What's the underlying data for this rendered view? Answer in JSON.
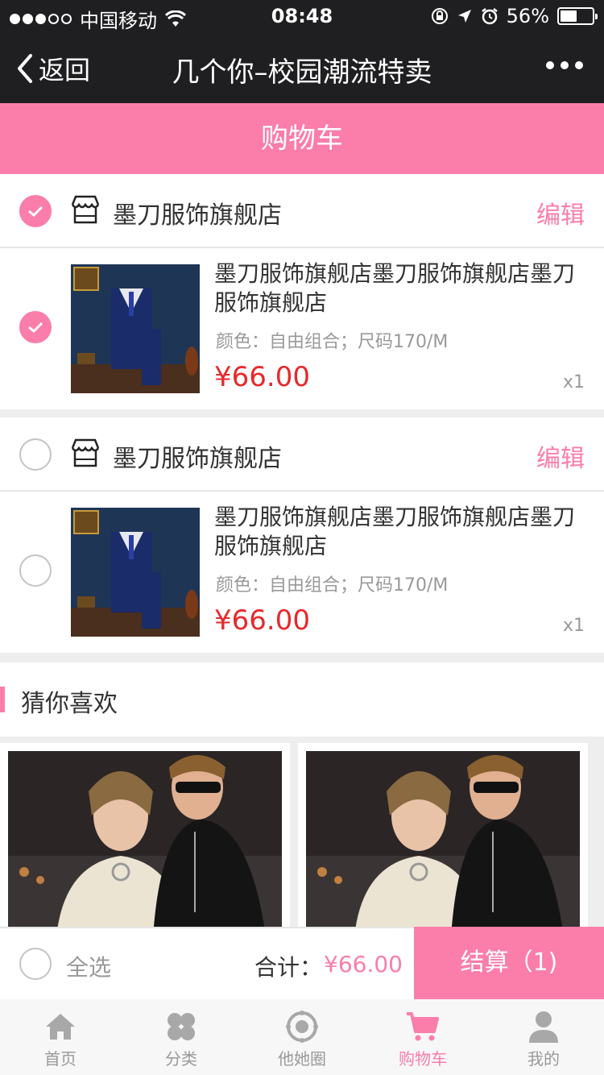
{
  "status_bar": {
    "carrier": "中国移动",
    "time": "08:48",
    "battery": "56%",
    "battery_level": 0.56
  },
  "nav": {
    "back_label": "返回",
    "title": "几个你–校园潮流特卖"
  },
  "page_title": "购物车",
  "cart": [
    {
      "shop_name": "墨刀服饰旗舰店",
      "edit_label": "编辑",
      "shop_checked": true,
      "item": {
        "checked": true,
        "title": "墨刀服饰旗舰店墨刀服饰旗舰店墨刀服饰旗舰店",
        "spec": "颜色：自由组合；尺码170/M",
        "price": "¥66.00",
        "qty": "x1"
      }
    },
    {
      "shop_name": "墨刀服饰旗舰店",
      "edit_label": "编辑",
      "shop_checked": false,
      "item": {
        "checked": false,
        "title": "墨刀服饰旗舰店墨刀服饰旗舰店墨刀服饰旗舰店",
        "spec": "颜色：自由组合；尺码170/M",
        "price": "¥66.00",
        "qty": "x1"
      }
    }
  ],
  "recommend": {
    "title": "猜你喜欢"
  },
  "footer": {
    "select_all": "全选",
    "total_label": "合计：",
    "total_price": "¥66.00",
    "checkout_label": "结算（1)"
  },
  "tabs": [
    {
      "label": "首页",
      "icon": "home-icon"
    },
    {
      "label": "分类",
      "icon": "category-icon"
    },
    {
      "label": "他她圈",
      "icon": "circle-icon"
    },
    {
      "label": "购物车",
      "icon": "cart-icon",
      "active": true
    },
    {
      "label": "我的",
      "icon": "user-icon"
    }
  ],
  "colors": {
    "accent": "#fb7daa",
    "price": "#e8282b",
    "header": "#1f1f21"
  }
}
